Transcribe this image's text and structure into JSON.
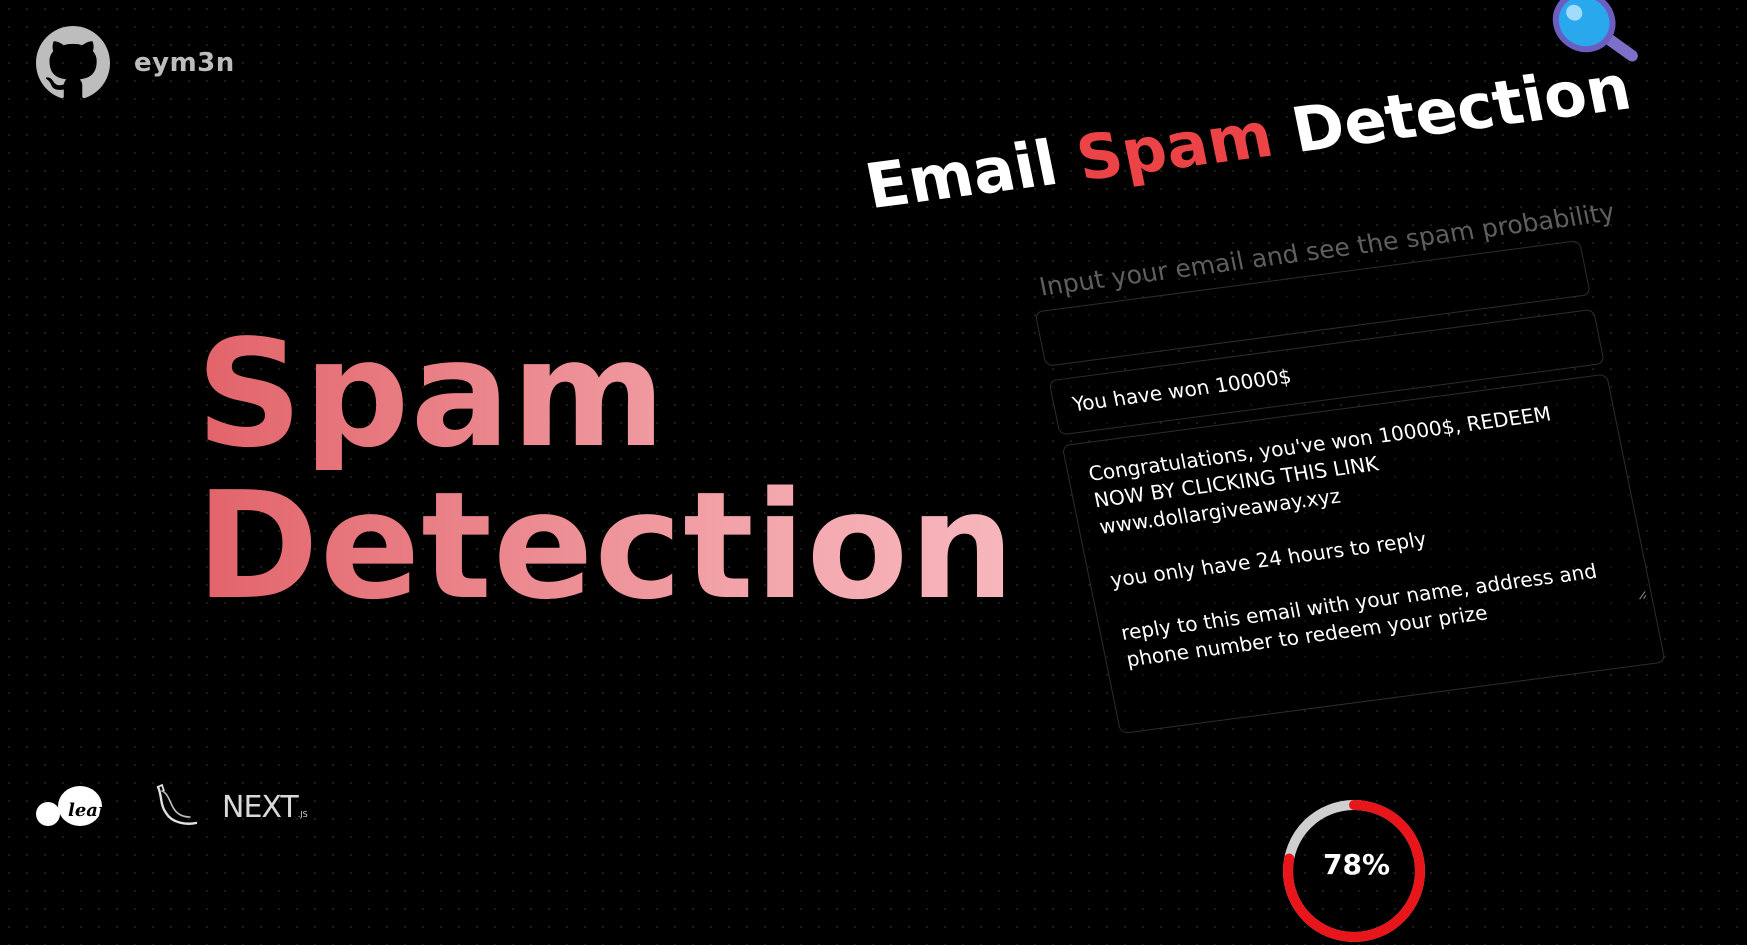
{
  "header": {
    "username": "eym3n"
  },
  "hero": {
    "line1": "Spam",
    "line2": "Detection"
  },
  "panel": {
    "title_word1": "Email",
    "title_word2": "Spam",
    "title_word3": "Detection",
    "subtitle": "Input your email and see the spam probability",
    "subject_value": "You have won 10000$",
    "body_lines": [
      "Congratulations, you've won 10000$, REDEEM NOW BY CLICKING THIS LINK",
      "www.dollargiveaway.xyz",
      "",
      "you only have 24 hours to reply",
      "",
      "reply to this email with your name, address and phone number to redeem your prize"
    ]
  },
  "result": {
    "probability_label": "78%",
    "probability": 0.78,
    "ring_color": "#e8151b",
    "ring_track": "#cfcfcf"
  },
  "footer_logos": {
    "sklearn_text": "lear n",
    "flask_icon": "flask-icon",
    "next_text": "NEXT",
    "next_suffix": ".JS"
  },
  "colors": {
    "accent": "#ec4346",
    "hero_start": "#e2636a",
    "hero_end": "#f7b7bd",
    "background": "#000000"
  }
}
